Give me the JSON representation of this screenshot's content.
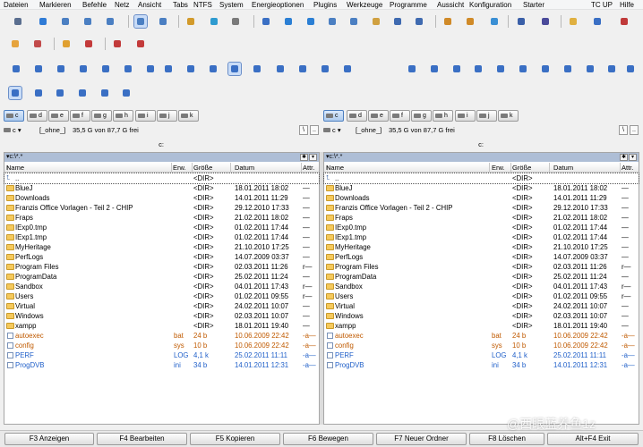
{
  "menu": [
    "Dateien",
    "Markieren",
    "Befehle",
    "Netz",
    "Ansicht",
    "Tabs",
    "NTFS",
    "System",
    "Energieoptionen",
    "Plugins",
    "Werkzeuge",
    "Programme",
    "Aussicht",
    "Konfiguration",
    "Starter",
    "TC UP",
    "Hilfe"
  ],
  "drives": [
    "c",
    "d",
    "e",
    "f",
    "g",
    "h",
    "i",
    "j",
    "k"
  ],
  "left": {
    "drive": "c",
    "label": "[_ohne_]",
    "free": "35,5 G von 87,7 G frei",
    "path": "c:",
    "tab": "c:\\*.*",
    "columns": {
      "name": "Name",
      "ext": "Erw.",
      "size": "Größe",
      "date": "Datum",
      "attr": "Attr."
    },
    "rows": [
      {
        "name": "..",
        "ext": "",
        "size": "<DIR>",
        "date": "",
        "attr": "",
        "kind": "up"
      },
      {
        "name": "BlueJ",
        "ext": "",
        "size": "<DIR>",
        "date": "18.01.2011 18:02",
        "attr": "—",
        "kind": "dir"
      },
      {
        "name": "Downloads",
        "ext": "",
        "size": "<DIR>",
        "date": "14.01.2011 11:29",
        "attr": "—",
        "kind": "dir"
      },
      {
        "name": "Franzis Office Vorlagen - Teil 2 - CHIP",
        "ext": "",
        "size": "<DIR>",
        "date": "29.12.2010 17:33",
        "attr": "—",
        "kind": "dir"
      },
      {
        "name": "Fraps",
        "ext": "",
        "size": "<DIR>",
        "date": "21.02.2011 18:02",
        "attr": "—",
        "kind": "dir"
      },
      {
        "name": "IExp0.tmp",
        "ext": "",
        "size": "<DIR>",
        "date": "01.02.2011 17:44",
        "attr": "—",
        "kind": "dir"
      },
      {
        "name": "IExp1.tmp",
        "ext": "",
        "size": "<DIR>",
        "date": "01.02.2011 17:44",
        "attr": "—",
        "kind": "dir"
      },
      {
        "name": "MyHeritage",
        "ext": "",
        "size": "<DIR>",
        "date": "21.10.2010 17:25",
        "attr": "—",
        "kind": "dir"
      },
      {
        "name": "PerfLogs",
        "ext": "",
        "size": "<DIR>",
        "date": "14.07.2009 03:37",
        "attr": "—",
        "kind": "dir"
      },
      {
        "name": "Program Files",
        "ext": "",
        "size": "<DIR>",
        "date": "02.03.2011 11:26",
        "attr": "r—",
        "kind": "dir"
      },
      {
        "name": "ProgramData",
        "ext": "",
        "size": "<DIR>",
        "date": "25.02.2011 11:24",
        "attr": "—",
        "kind": "dir"
      },
      {
        "name": "Sandbox",
        "ext": "",
        "size": "<DIR>",
        "date": "04.01.2011 17:43",
        "attr": "r—",
        "kind": "dir"
      },
      {
        "name": "Users",
        "ext": "",
        "size": "<DIR>",
        "date": "01.02.2011 09:55",
        "attr": "r—",
        "kind": "dir"
      },
      {
        "name": "Virtual",
        "ext": "",
        "size": "<DIR>",
        "date": "24.02.2011 10:07",
        "attr": "—",
        "kind": "dir"
      },
      {
        "name": "Windows",
        "ext": "",
        "size": "<DIR>",
        "date": "02.03.2011 10:07",
        "attr": "—",
        "kind": "dir"
      },
      {
        "name": "xampp",
        "ext": "",
        "size": "<DIR>",
        "date": "18.01.2011 19:40",
        "attr": "—",
        "kind": "dir"
      },
      {
        "name": "autoexec",
        "ext": "bat",
        "size": "24 b",
        "date": "10.06.2009 22:42",
        "attr": "-a—",
        "kind": "orange"
      },
      {
        "name": "config",
        "ext": "sys",
        "size": "10 b",
        "date": "10.06.2009 22:42",
        "attr": "-a—",
        "kind": "orange"
      },
      {
        "name": "PERF",
        "ext": "LOG",
        "size": "4,1 k",
        "date": "25.02.2011 11:11",
        "attr": "-a—",
        "kind": "blue"
      },
      {
        "name": "ProgDVB",
        "ext": "ini",
        "size": "34 b",
        "date": "14.01.2011 12:31",
        "attr": "-a—",
        "kind": "blue"
      }
    ]
  },
  "right": {
    "drive": "c",
    "label": "[_ohne_]",
    "free": "35,5 G von 87,7 G frei",
    "path": "c:",
    "tab": "c:\\*.*",
    "columns": {
      "name": "Name",
      "ext": "Erw.",
      "size": "Größe",
      "date": "Datum",
      "attr": "Attr."
    },
    "rows": [
      {
        "name": "..",
        "ext": "",
        "size": "<DIR>",
        "date": "",
        "attr": "",
        "kind": "up"
      },
      {
        "name": "BlueJ",
        "ext": "",
        "size": "<DIR>",
        "date": "18.01.2011 18:02",
        "attr": "—",
        "kind": "dir"
      },
      {
        "name": "Downloads",
        "ext": "",
        "size": "<DIR>",
        "date": "14.01.2011 11:29",
        "attr": "—",
        "kind": "dir"
      },
      {
        "name": "Franzis Office Vorlagen - Teil 2 - CHIP",
        "ext": "",
        "size": "<DIR>",
        "date": "29.12.2010 17:33",
        "attr": "—",
        "kind": "dir"
      },
      {
        "name": "Fraps",
        "ext": "",
        "size": "<DIR>",
        "date": "21.02.2011 18:02",
        "attr": "—",
        "kind": "dir"
      },
      {
        "name": "IExp0.tmp",
        "ext": "",
        "size": "<DIR>",
        "date": "01.02.2011 17:44",
        "attr": "—",
        "kind": "dir"
      },
      {
        "name": "IExp1.tmp",
        "ext": "",
        "size": "<DIR>",
        "date": "01.02.2011 17:44",
        "attr": "—",
        "kind": "dir"
      },
      {
        "name": "MyHeritage",
        "ext": "",
        "size": "<DIR>",
        "date": "21.10.2010 17:25",
        "attr": "—",
        "kind": "dir"
      },
      {
        "name": "PerfLogs",
        "ext": "",
        "size": "<DIR>",
        "date": "14.07.2009 03:37",
        "attr": "—",
        "kind": "dir"
      },
      {
        "name": "Program Files",
        "ext": "",
        "size": "<DIR>",
        "date": "02.03.2011 11:26",
        "attr": "r—",
        "kind": "dir"
      },
      {
        "name": "ProgramData",
        "ext": "",
        "size": "<DIR>",
        "date": "25.02.2011 11:24",
        "attr": "—",
        "kind": "dir"
      },
      {
        "name": "Sandbox",
        "ext": "",
        "size": "<DIR>",
        "date": "04.01.2011 17:43",
        "attr": "r—",
        "kind": "dir"
      },
      {
        "name": "Users",
        "ext": "",
        "size": "<DIR>",
        "date": "01.02.2011 09:55",
        "attr": "r—",
        "kind": "dir"
      },
      {
        "name": "Virtual",
        "ext": "",
        "size": "<DIR>",
        "date": "24.02.2011 10:07",
        "attr": "—",
        "kind": "dir"
      },
      {
        "name": "Windows",
        "ext": "",
        "size": "<DIR>",
        "date": "02.03.2011 10:07",
        "attr": "—",
        "kind": "dir"
      },
      {
        "name": "xampp",
        "ext": "",
        "size": "<DIR>",
        "date": "18.01.2011 19:40",
        "attr": "—",
        "kind": "dir"
      },
      {
        "name": "autoexec",
        "ext": "bat",
        "size": "24 b",
        "date": "10.06.2009 22:42",
        "attr": "-a—",
        "kind": "orange"
      },
      {
        "name": "config",
        "ext": "sys",
        "size": "10 b",
        "date": "10.06.2009 22:42",
        "attr": "-a—",
        "kind": "orange"
      },
      {
        "name": "PERF",
        "ext": "LOG",
        "size": "4,1 k",
        "date": "25.02.2011 11:11",
        "attr": "-a—",
        "kind": "blue"
      },
      {
        "name": "ProgDVB",
        "ext": "ini",
        "size": "34 b",
        "date": "14.01.2011 12:31",
        "attr": "-a—",
        "kind": "blue"
      }
    ]
  },
  "fkeys": [
    "F3 Anzeigen",
    "F4 Bearbeiten",
    "F5 Kopieren",
    "F6 Bewegen",
    "F7 Neuer Ordner",
    "F8 Löschen",
    "Alt+F4 Exit"
  ],
  "watermark": "@西眼蓝养鱼1z",
  "colors": {
    "orange_file": "#c05a00",
    "blue_file": "#1f5fc9",
    "tab_bar": "#aebed6",
    "folder": "#f5c95c"
  }
}
